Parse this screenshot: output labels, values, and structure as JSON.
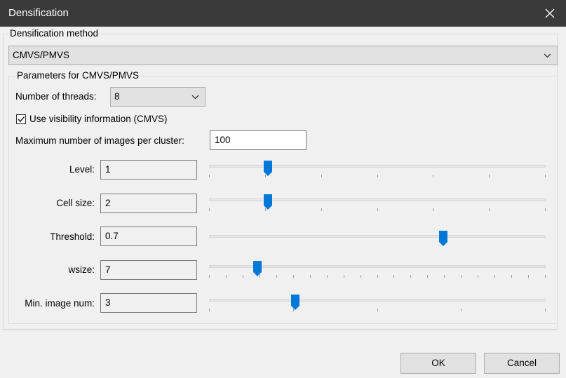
{
  "window": {
    "title": "Densification"
  },
  "method_group": {
    "label": "Densification method",
    "selected": "CMVS/PMVS"
  },
  "params_group": {
    "label": "Parameters for CMVS/PMVS",
    "threads": {
      "label": "Number of threads:",
      "value": "8"
    },
    "visibility": {
      "label": "Use visibility information (CMVS)",
      "checked": true
    },
    "max_images": {
      "label": "Maximum number of images per cluster:",
      "value": "100"
    },
    "sliders": [
      {
        "label": "Level:",
        "value": "1",
        "position": 0.175,
        "ticks": 7
      },
      {
        "label": "Cell size:",
        "value": "2",
        "position": 0.175,
        "ticks": 7
      },
      {
        "label": "Threshold:",
        "value": "0.7",
        "position": 0.695,
        "ticks": 0
      },
      {
        "label": "wsize:",
        "value": "7",
        "position": 0.144,
        "ticks": 21
      },
      {
        "label": "Min. image num:",
        "value": "3",
        "position": 0.256,
        "ticks": 5
      }
    ]
  },
  "buttons": {
    "ok": "OK",
    "cancel": "Cancel"
  },
  "colors": {
    "accent": "#0078d7",
    "titlebar": "#3a3a3a"
  },
  "icons": {
    "close": "close-icon",
    "dropdown": "chevron-down-icon",
    "checkmark": "checkmark-icon",
    "thumb": "slider-thumb-icon"
  }
}
